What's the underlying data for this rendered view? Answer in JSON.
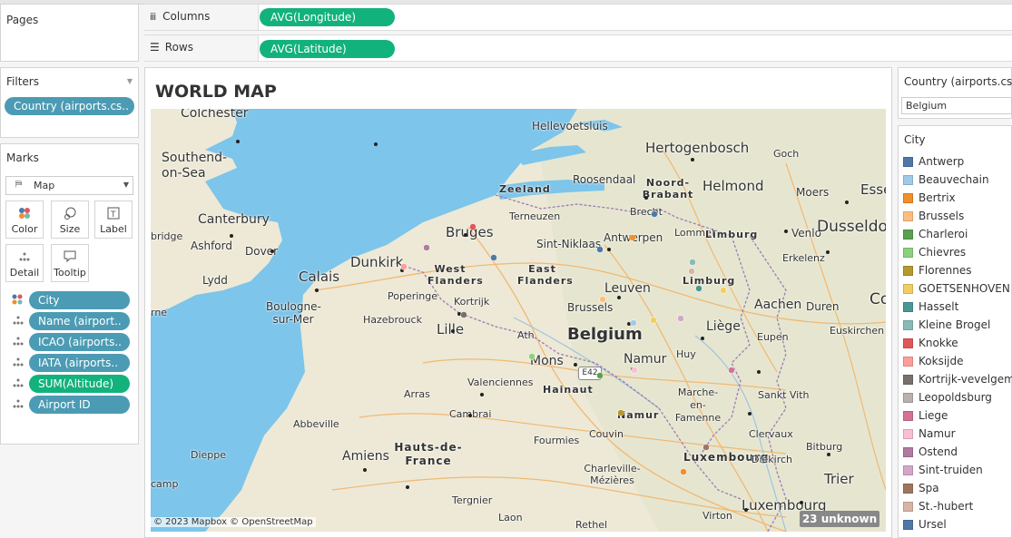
{
  "pages": {
    "title": "Pages"
  },
  "shelves": {
    "columns_label": "Columns",
    "columns_pill": "AVG(Longitude)",
    "rows_label": "Rows",
    "rows_pill": "AVG(Latitude)"
  },
  "filters": {
    "title": "Filters",
    "pill": "Country (airports.cs.."
  },
  "marks": {
    "title": "Marks",
    "type": "Map",
    "buttons": {
      "color": "Color",
      "size": "Size",
      "label": "Label",
      "detail": "Detail",
      "tooltip": "Tooltip"
    },
    "fields": [
      "City",
      "Name (airport..",
      "ICAO (airports..",
      "IATA (airports..",
      "SUM(Altitude)",
      "Airport ID"
    ]
  },
  "view": {
    "title": "WORLD MAP",
    "attribution": "© 2023 Mapbox © OpenStreetMap",
    "unknown": "23 unknown",
    "route_badge": "E42",
    "map_labels": [
      "Colchester",
      "Hellevoetsluis",
      "Hertogenbosch",
      "Southend-on-Sea",
      "Goch",
      "Roosendaal",
      "Noord-Brabant",
      "Helmond",
      "Zeeland",
      "Moers",
      "Esse",
      "Terneuzen",
      "Canterbury",
      "Brecht",
      "Venlo",
      "Dusseldor",
      "Ashford",
      "Dover",
      "Bruges",
      "Sint-Niklaas",
      "Antwerpen",
      "Lommel",
      "Limburg",
      "Erkelenz",
      "bridge",
      "Lydd",
      "Dunkirk",
      "Calais",
      "West Flanders",
      "East Flanders",
      "Limburg",
      "Poperinge",
      "Kortrijk",
      "Leuven",
      "Aachen",
      "Cologn",
      "rne",
      "Boulogne-sur-Mer",
      "Hazebrouck",
      "Brussels",
      "Liège",
      "Duren",
      "Lille",
      "Belgium",
      "Ath",
      "Eupen",
      "Euskirchen",
      "Mons",
      "Namur",
      "Huy",
      "Arras",
      "Valenciennes",
      "Hainaut",
      "Marche-en-Famenne",
      "Sankt Vith",
      "Cambrai",
      "Namur",
      "Abbeville",
      "Fourmies",
      "Couvin",
      "Clervaux",
      "Bitburg",
      "Dieppe",
      "Amiens",
      "Hauts-de-France",
      "Luxembourg",
      "Diekirch",
      "Charleville-Mézières",
      "Trier",
      "camp",
      "Tergnier",
      "Laon",
      "Virton",
      "Luxembourg",
      "Rethel"
    ]
  },
  "country_filter": {
    "title": "Country (airports.csv)",
    "value": "Belgium"
  },
  "legend": {
    "title": "City",
    "items": [
      {
        "label": "Antwerp",
        "color": "#4e79a7"
      },
      {
        "label": "Beauvechain",
        "color": "#a0cbe8"
      },
      {
        "label": "Bertrix",
        "color": "#f28e2b"
      },
      {
        "label": "Brussels",
        "color": "#ffbe7d"
      },
      {
        "label": "Charleroi",
        "color": "#59a14f"
      },
      {
        "label": "Chievres",
        "color": "#8cd17d"
      },
      {
        "label": "Florennes",
        "color": "#b6992d"
      },
      {
        "label": "GOETSENHOVEN",
        "color": "#f1ce63"
      },
      {
        "label": "Hasselt",
        "color": "#499894"
      },
      {
        "label": "Kleine Brogel",
        "color": "#86bcb6"
      },
      {
        "label": "Knokke",
        "color": "#e15759"
      },
      {
        "label": "Koksijde",
        "color": "#ff9d9a"
      },
      {
        "label": "Kortrijk-vevelgem",
        "color": "#79706e"
      },
      {
        "label": "Leopoldsburg",
        "color": "#bab0ac"
      },
      {
        "label": "Liege",
        "color": "#d37295"
      },
      {
        "label": "Namur",
        "color": "#fabfd2"
      },
      {
        "label": "Ostend",
        "color": "#b07aa1"
      },
      {
        "label": "Sint-truiden",
        "color": "#d4a6c8"
      },
      {
        "label": "Spa",
        "color": "#9d7660"
      },
      {
        "label": "St.-hubert",
        "color": "#d7b5a6"
      },
      {
        "label": "Ursel",
        "color": "#4e79a7"
      }
    ]
  }
}
